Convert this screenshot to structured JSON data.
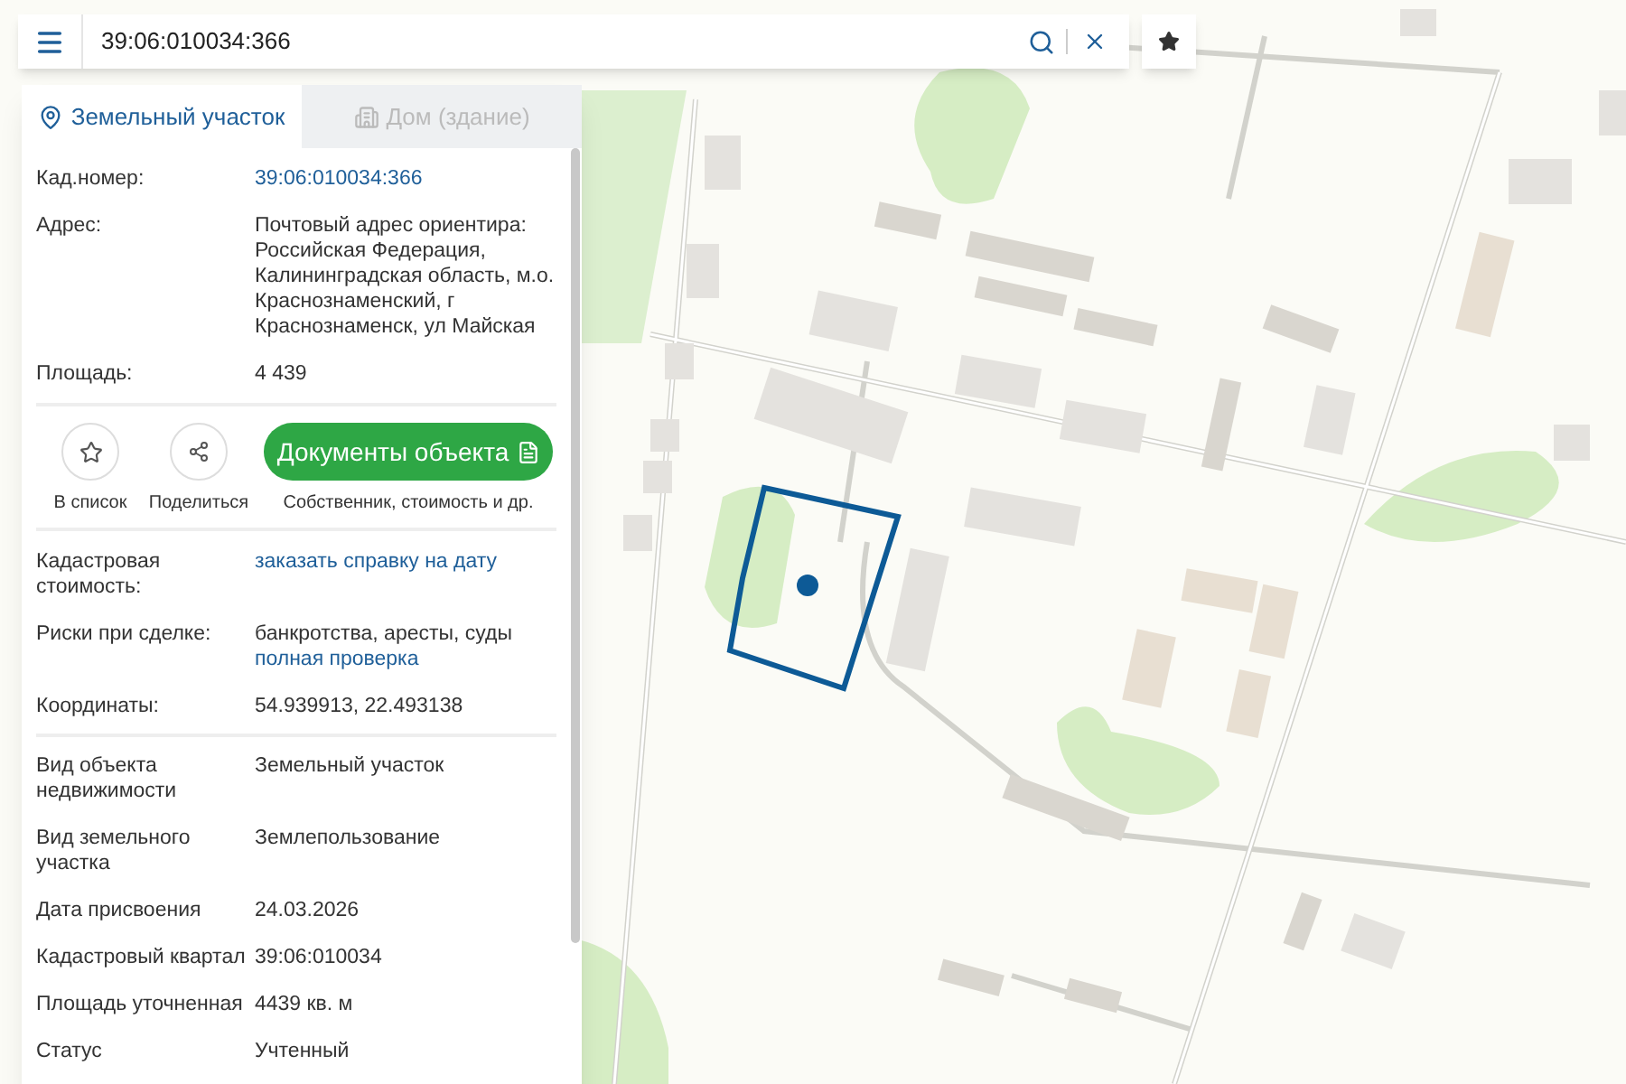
{
  "search": {
    "value": "39:06:010034:366"
  },
  "tabs": [
    {
      "label": "Земельный участок",
      "selected": true,
      "kind": "land"
    },
    {
      "label": "Дом (здание)",
      "selected": false,
      "kind": "building"
    }
  ],
  "summary": [
    {
      "label": "Кад.номер:",
      "kind": "link",
      "value": "39:06:010034:366"
    },
    {
      "label": "Адрес:",
      "kind": "text",
      "value": "Почтовый адрес ориентира: Российская Федерация, Калининградская область, м.о. Краснознаменский, г Краснознаменск, ул Майская"
    },
    {
      "label": "Площадь:",
      "kind": "text",
      "value": "4 439"
    }
  ],
  "actions": [
    {
      "label": "В список",
      "kind": "star"
    },
    {
      "label": "Поделиться",
      "kind": "share"
    }
  ],
  "documents_button": {
    "label": "Документы объекта",
    "caption": "Собственник, стоимость и др."
  },
  "checks": [
    {
      "label": "Кадастровая стоимость:",
      "kind": "link",
      "value": "заказать справку на дату"
    },
    {
      "label": "Риски при сделке:",
      "kind": "text_link",
      "value": "банкротства, аресты, суды",
      "link": "полная проверка"
    },
    {
      "label": "Координаты:",
      "kind": "text",
      "value": "54.939913, 22.493138"
    }
  ],
  "details": [
    {
      "label": "Вид объекта недвижимости",
      "kind": "text",
      "value": "Земельный участок"
    },
    {
      "label": "Вид земельного участка",
      "kind": "text",
      "value": "Землепользование"
    },
    {
      "label": "Дата присвоения",
      "kind": "text",
      "value": "24.03.2026"
    },
    {
      "label": "Кадастровый квартал",
      "kind": "text",
      "value": "39:06:010034"
    },
    {
      "label": "Площадь уточненная",
      "kind": "text",
      "value": "4439 кв. м"
    },
    {
      "label": "Статус",
      "kind": "text",
      "value": "Учтенный"
    }
  ]
}
